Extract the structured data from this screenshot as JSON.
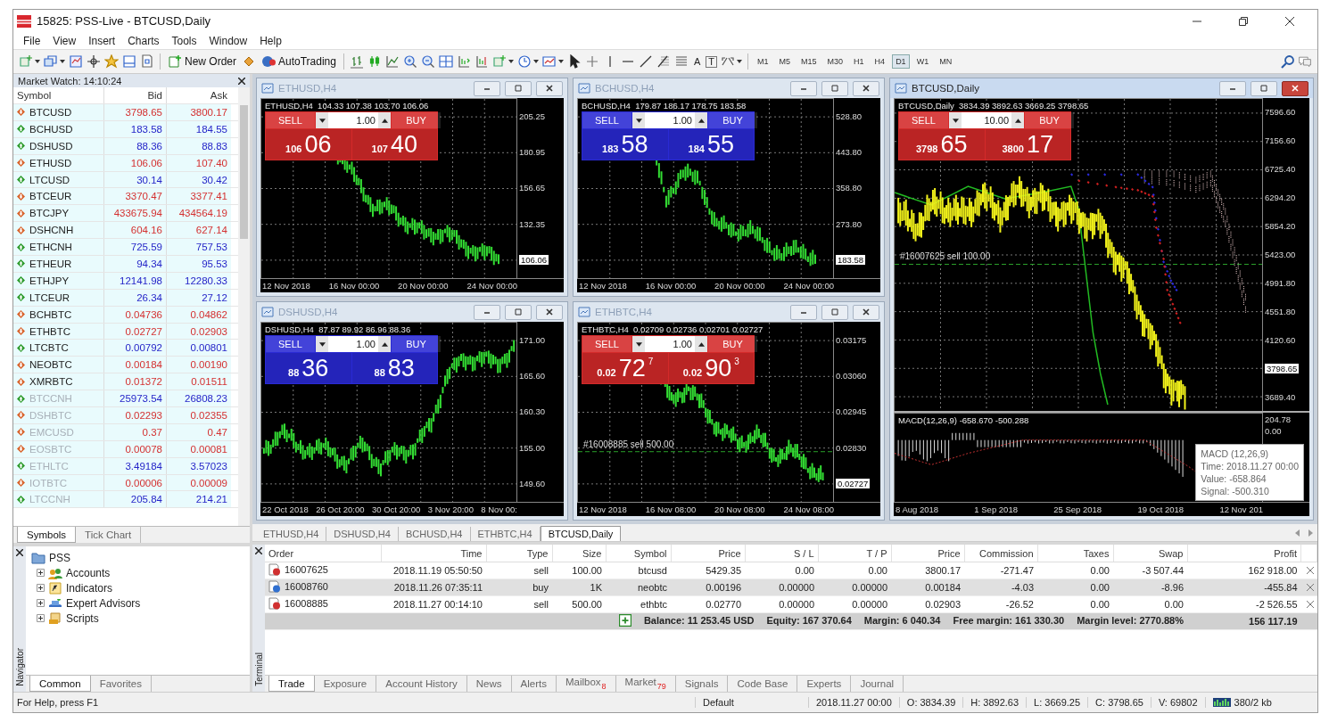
{
  "window": {
    "title": "15825: PSS-Live - BTCUSD,Daily"
  },
  "menu": [
    "File",
    "View",
    "Insert",
    "Charts",
    "Tools",
    "Window",
    "Help"
  ],
  "toolbar": {
    "new_order": "New Order",
    "auto_trading": "AutoTrading",
    "text_tools": [
      "A",
      "T"
    ],
    "timeframes": [
      {
        "label": "M1",
        "selected": false
      },
      {
        "label": "M5",
        "selected": false
      },
      {
        "label": "M15",
        "selected": false
      },
      {
        "label": "M30",
        "selected": false
      },
      {
        "label": "H1",
        "selected": false
      },
      {
        "label": "H4",
        "selected": false
      },
      {
        "label": "D1",
        "selected": true
      },
      {
        "label": "W1",
        "selected": false
      },
      {
        "label": "MN",
        "selected": false
      }
    ]
  },
  "market_watch": {
    "title": "Market Watch: 14:10:24",
    "columns": [
      "Symbol",
      "Bid",
      "Ask"
    ],
    "rows": [
      {
        "symbol": "BTCUSD",
        "bid": "3798.65",
        "ask": "3800.17",
        "rising": false,
        "dimmed": false
      },
      {
        "symbol": "BCHUSD",
        "bid": "183.58",
        "ask": "184.55",
        "rising": true,
        "dimmed": false
      },
      {
        "symbol": "DSHUSD",
        "bid": "88.36",
        "ask": "88.83",
        "rising": true,
        "dimmed": false
      },
      {
        "symbol": "ETHUSD",
        "bid": "106.06",
        "ask": "107.40",
        "rising": false,
        "dimmed": false
      },
      {
        "symbol": "LTCUSD",
        "bid": "30.14",
        "ask": "30.42",
        "rising": true,
        "dimmed": false
      },
      {
        "symbol": "BTCEUR",
        "bid": "3370.47",
        "ask": "3377.41",
        "rising": false,
        "dimmed": false
      },
      {
        "symbol": "BTCJPY",
        "bid": "433675.94",
        "ask": "434564.19",
        "rising": false,
        "dimmed": false
      },
      {
        "symbol": "DSHCNH",
        "bid": "604.16",
        "ask": "627.14",
        "rising": false,
        "dimmed": false
      },
      {
        "symbol": "ETHCNH",
        "bid": "725.59",
        "ask": "757.53",
        "rising": true,
        "dimmed": false
      },
      {
        "symbol": "ETHEUR",
        "bid": "94.34",
        "ask": "95.53",
        "rising": true,
        "dimmed": false
      },
      {
        "symbol": "ETHJPY",
        "bid": "12141.98",
        "ask": "12280.33",
        "rising": true,
        "dimmed": false
      },
      {
        "symbol": "LTCEUR",
        "bid": "26.34",
        "ask": "27.12",
        "rising": true,
        "dimmed": false
      },
      {
        "symbol": "BCHBTC",
        "bid": "0.04736",
        "ask": "0.04862",
        "rising": false,
        "dimmed": false
      },
      {
        "symbol": "ETHBTC",
        "bid": "0.02727",
        "ask": "0.02903",
        "rising": false,
        "dimmed": false
      },
      {
        "symbol": "LTCBTC",
        "bid": "0.00792",
        "ask": "0.00801",
        "rising": true,
        "dimmed": false
      },
      {
        "symbol": "NEOBTC",
        "bid": "0.00184",
        "ask": "0.00190",
        "rising": false,
        "dimmed": false
      },
      {
        "symbol": "XMRBTC",
        "bid": "0.01372",
        "ask": "0.01511",
        "rising": false,
        "dimmed": false
      },
      {
        "symbol": "BTCCNH",
        "bid": "25973.54",
        "ask": "26808.23",
        "rising": true,
        "dimmed": true
      },
      {
        "symbol": "DSHBTC",
        "bid": "0.02293",
        "ask": "0.02355",
        "rising": false,
        "dimmed": true
      },
      {
        "symbol": "EMCUSD",
        "bid": "0.37",
        "ask": "0.47",
        "rising": false,
        "dimmed": true
      },
      {
        "symbol": "EOSBTC",
        "bid": "0.00078",
        "ask": "0.00081",
        "rising": false,
        "dimmed": true
      },
      {
        "symbol": "ETHLTC",
        "bid": "3.49184",
        "ask": "3.57023",
        "rising": true,
        "dimmed": true
      },
      {
        "symbol": "IOTBTC",
        "bid": "0.00006",
        "ask": "0.00009",
        "rising": false,
        "dimmed": true
      },
      {
        "symbol": "LTCCNH",
        "bid": "205.84",
        "ask": "214.21",
        "rising": true,
        "dimmed": true
      }
    ],
    "tabs": [
      {
        "label": "Symbols",
        "selected": true
      },
      {
        "label": "Tick Chart",
        "selected": false
      }
    ]
  },
  "navigator": {
    "label": "Navigator",
    "tree": [
      {
        "label": "PSS",
        "children": [
          {
            "label": "Accounts",
            "expanded": false
          },
          {
            "label": "Indicators",
            "expanded": false
          },
          {
            "label": "Expert Advisors",
            "expanded": false
          },
          {
            "label": "Scripts",
            "expanded": false
          }
        ]
      }
    ],
    "tabs": [
      {
        "label": "Common",
        "selected": true
      },
      {
        "label": "Favorites",
        "selected": false
      }
    ]
  },
  "charts": [
    {
      "title": "ETHUSD,H4",
      "active": false,
      "header": "ETHUSD,H4  104.33 107.38 103.70 106.06",
      "panel": {
        "color": "#d42a2a",
        "sell": "SELL",
        "buy": "BUY",
        "lot": "1.00",
        "bid_small": "106",
        "bid_big": "06",
        "ask_small": "107",
        "ask_big": "40"
      },
      "y_labels": [
        {
          "text": "205.25",
          "boxed": false
        },
        {
          "text": "180.95",
          "boxed": false
        },
        {
          "text": "156.65",
          "boxed": false
        },
        {
          "text": "132.35",
          "boxed": false
        },
        {
          "text": "106.06",
          "boxed": true
        }
      ],
      "x_labels": [
        "12 Nov 2018",
        "16 Nov 00:00",
        "20 Nov 00:00",
        "24 Nov 00:00"
      ]
    },
    {
      "title": "DSHUSD,H4",
      "active": false,
      "header": "DSHUSD,H4  87.87 89.92 86.96 88.36",
      "panel": {
        "color": "#2a2ad4",
        "sell": "SELL",
        "buy": "BUY",
        "lot": "1.00",
        "bid_small": "88",
        "bid_big": "36",
        "ask_small": "88",
        "ask_big": "83"
      },
      "y_labels": [
        {
          "text": "171.00",
          "boxed": false
        },
        {
          "text": "165.60",
          "boxed": false
        },
        {
          "text": "160.30",
          "boxed": false
        },
        {
          "text": "155.00",
          "boxed": false
        },
        {
          "text": "149.60",
          "boxed": false
        }
      ],
      "x_labels": [
        "22 Oct 2018",
        "26 Oct 20:00",
        "30 Oct 20:00",
        "3 Nov 20:00",
        "8 Nov 00:"
      ]
    },
    {
      "title": "BCHUSD,H4",
      "active": false,
      "header": "BCHUSD,H4  179.87 186.17 178.75 183.58",
      "panel": {
        "color": "#2a2ad4",
        "sell": "SELL",
        "buy": "BUY",
        "lot": "1.00",
        "bid_small": "183",
        "bid_big": "58",
        "ask_small": "184",
        "ask_big": "55"
      },
      "y_labels": [
        {
          "text": "528.80",
          "boxed": false
        },
        {
          "text": "443.80",
          "boxed": false
        },
        {
          "text": "358.80",
          "boxed": false
        },
        {
          "text": "273.80",
          "boxed": false
        },
        {
          "text": "183.58",
          "boxed": true
        }
      ],
      "x_labels": [
        "12 Nov 2018",
        "16 Nov 00:00",
        "20 Nov 00:00",
        "24 Nov 00:00"
      ]
    },
    {
      "title": "ETHBTC,H4",
      "active": false,
      "header": "ETHBTC,H4  0.02709 0.02736 0.02701 0.02727",
      "panel": {
        "color": "#d42a2a",
        "sell": "SELL",
        "buy": "BUY",
        "lot": "1.00",
        "bid_small": "0.02",
        "bid_big": "72",
        "bid_sup": "7",
        "ask_small": "0.02",
        "ask_big": "90",
        "ask_sup": "3"
      },
      "order_line": "#16008885 sell 500.00",
      "y_labels": [
        {
          "text": "0.03175",
          "boxed": false
        },
        {
          "text": "0.03060",
          "boxed": false
        },
        {
          "text": "0.02945",
          "boxed": false
        },
        {
          "text": "0.02830",
          "boxed": false
        },
        {
          "text": "0.02727",
          "boxed": true
        }
      ],
      "x_labels": [
        "12 Nov 2018",
        "16 Nov 08:00",
        "20 Nov 08:00",
        "24 Nov 08:00"
      ]
    },
    {
      "title": "BTCUSD,Daily",
      "active": true,
      "header": "BTCUSD,Daily  3834.39 3892.63 3669.25 3798.65",
      "panel": {
        "color": "#d42a2a",
        "sell": "SELL",
        "buy": "BUY",
        "lot": "10.00",
        "bid_small": "3798",
        "bid_big": "65",
        "ask_small": "3800",
        "ask_big": "17"
      },
      "order_line": "#16007625 sell 100.00",
      "y_labels": [
        {
          "text": "7596.60",
          "boxed": false
        },
        {
          "text": "7156.60",
          "boxed": false
        },
        {
          "text": "6725.40",
          "boxed": false
        },
        {
          "text": "6294.20",
          "boxed": false
        },
        {
          "text": "5854.20",
          "boxed": false
        },
        {
          "text": "5423.00",
          "boxed": false
        },
        {
          "text": "4991.80",
          "boxed": false
        },
        {
          "text": "4551.80",
          "boxed": false
        },
        {
          "text": "4120.60",
          "boxed": false
        },
        {
          "text": "3798.65",
          "boxed": true
        },
        {
          "text": "3689.40",
          "boxed": false
        }
      ],
      "indicator": {
        "label": "MACD(12,26,9) -658.670 -500.288",
        "y_labels": [
          "204.78",
          "0.00"
        ],
        "tooltip": [
          "MACD (12,26,9)",
          "Time: 2018.11.27 00:00",
          "Value: -658.864",
          "Signal: -500.310"
        ]
      },
      "x_labels": [
        "8 Aug 2018",
        "1 Sep 2018",
        "25 Sep 2018",
        "19 Oct 2018",
        "12 Nov 201"
      ]
    }
  ],
  "chart_tabs": [
    {
      "label": "ETHUSD,H4",
      "selected": false
    },
    {
      "label": "DSHUSD,H4",
      "selected": false
    },
    {
      "label": "BCHUSD,H4",
      "selected": false
    },
    {
      "label": "ETHBTC,H4",
      "selected": false
    },
    {
      "label": "BTCUSD,Daily",
      "selected": true
    }
  ],
  "terminal": {
    "label": "Terminal",
    "columns": [
      "Order",
      "Time",
      "Type",
      "Size",
      "Symbol",
      "Price",
      "S / L",
      "T / P",
      "Price",
      "Commission",
      "Taxes",
      "Swap",
      "Profit"
    ],
    "rows": [
      {
        "color": "#d03030",
        "selected": false,
        "cells": [
          "16007625",
          "2018.11.19 05:50:50",
          "sell",
          "100.00",
          "btcusd",
          "5429.35",
          "0.00",
          "0.00",
          "3800.17",
          "-271.47",
          "0.00",
          "-3 507.44",
          "162 918.00"
        ]
      },
      {
        "color": "#3070d0",
        "selected": true,
        "cells": [
          "16008760",
          "2018.11.26 07:35:11",
          "buy",
          "1K",
          "neobtc",
          "0.00196",
          "0.00000",
          "0.00000",
          "0.00184",
          "-4.03",
          "0.00",
          "-8.96",
          "-455.84"
        ]
      },
      {
        "color": "#d03030",
        "selected": false,
        "cells": [
          "16008885",
          "2018.11.27 00:14:10",
          "sell",
          "500.00",
          "ethbtc",
          "0.02770",
          "0.00000",
          "0.00000",
          "0.02903",
          "-26.52",
          "0.00",
          "0.00",
          "-2 526.55"
        ]
      }
    ],
    "summary": [
      "Balance: 11 253.45 USD",
      "Equity: 167 370.64",
      "Margin: 6 040.34",
      "Free margin: 161 330.30",
      "Margin level: 2770.88%"
    ],
    "total": "156 117.19",
    "tabs": [
      {
        "label": "Trade",
        "selected": true
      },
      {
        "label": "Exposure",
        "selected": false
      },
      {
        "label": "Account History",
        "selected": false
      },
      {
        "label": "News",
        "selected": false
      },
      {
        "label": "Alerts",
        "selected": false
      },
      {
        "label": "Mailbox",
        "badge": "8",
        "selected": false
      },
      {
        "label": "Market",
        "badge": "79",
        "selected": false
      },
      {
        "label": "Signals",
        "selected": false
      },
      {
        "label": "Code Base",
        "selected": false
      },
      {
        "label": "Experts",
        "selected": false
      },
      {
        "label": "Journal",
        "selected": false
      }
    ]
  },
  "status_bar": {
    "help": "For Help, press F1",
    "profile": "Default",
    "items": [
      "2018.11.27 00:00",
      "O: 3834.39",
      "H: 3892.63",
      "L: 3669.25",
      "C: 3798.65",
      "V: 69802"
    ],
    "traffic": "380/2 kb"
  }
}
